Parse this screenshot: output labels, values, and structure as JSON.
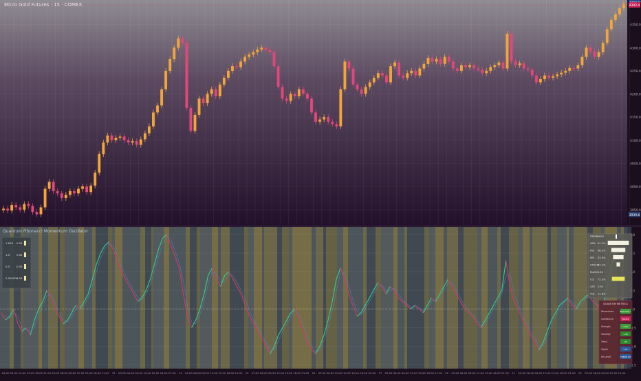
{
  "header": {
    "title": "Micro Gold Futures · 15 · COMEX"
  },
  "oscillator": {
    "title": "Quantum Fibonacci Momentum Oscillator"
  },
  "colors": {
    "bull": "#f2a63a",
    "bear": "#e0477a",
    "osc_up": "#2fd38a",
    "osc_down": "#d63a66",
    "osc_mid": "#3aa7d8",
    "grid": "#3c2b40",
    "accent_high": "#2b4a8c",
    "accent_current": "#c8245a"
  },
  "chart_data": [
    {
      "type": "candlestick",
      "title": "Micro Gold Futures · 15 · COMEX",
      "ylim": [
        3920,
        4400
      ],
      "price_ticks": [
        3950,
        4000,
        4050,
        4100,
        4150,
        4200,
        4250,
        4300,
        4350,
        4400
      ],
      "price_labels": [
        "3950.0",
        "4000.0",
        "4050.0",
        "4100.0",
        "4150.0",
        "4200.0",
        "4250.0",
        "4300.0",
        "4350.0",
        "4400.0"
      ],
      "marker_high": "4398.1",
      "marker_current": "4392.4",
      "marker_low": "3939.6",
      "close_series": [
        3952,
        3948,
        3960,
        3955,
        3950,
        3962,
        3958,
        3945,
        3940,
        3955,
        3995,
        4010,
        3990,
        3985,
        3975,
        3982,
        3990,
        3985,
        3995,
        4000,
        3988,
        4002,
        4030,
        4070,
        4095,
        4110,
        4100,
        4105,
        4108,
        4100,
        4095,
        4098,
        4090,
        4102,
        4115,
        4130,
        4160,
        4175,
        4210,
        4250,
        4275,
        4300,
        4320,
        4310,
        4170,
        4120,
        4155,
        4190,
        4180,
        4200,
        4210,
        4195,
        4220,
        4235,
        4250,
        4260,
        4258,
        4270,
        4280,
        4285,
        4290,
        4296,
        4300,
        4295,
        4290,
        4260,
        4215,
        4190,
        4185,
        4200,
        4195,
        4210,
        4200,
        4190,
        4160,
        4140,
        4145,
        4150,
        4140,
        4135,
        4130,
        4210,
        4270,
        4255,
        4220,
        4210,
        4200,
        4215,
        4225,
        4235,
        4245,
        4240,
        4225,
        4260,
        4268,
        4240,
        4235,
        4245,
        4250,
        4240,
        4255,
        4265,
        4278,
        4270,
        4275,
        4265,
        4280,
        4270,
        4255,
        4250,
        4262,
        4258,
        4262,
        4255,
        4252,
        4245,
        4250,
        4258,
        4262,
        4268,
        4255,
        4330,
        4270,
        4262,
        4266,
        4255,
        4252,
        4240,
        4225,
        4232,
        4240,
        4235,
        4238,
        4242,
        4246,
        4250,
        4256,
        4255,
        4262,
        4280,
        4300,
        4292,
        4280,
        4290,
        4310,
        4340,
        4360,
        4372,
        4385,
        4395
      ]
    },
    {
      "type": "line",
      "title": "Quantum Fibonacci Momentum Oscillator",
      "ylim": [
        -1.6,
        2.2
      ],
      "y_ticks": [
        2.0,
        1.5,
        1.0,
        0.5,
        0.0,
        -0.5,
        -1.0,
        -1.5
      ],
      "y_labels": [
        "2.0",
        "1.5",
        "1.0",
        "0.5",
        "0.0",
        "-0.5",
        "-1.0",
        "-1.5"
      ],
      "x_labels": [
        "09:00",
        "09:00",
        "12:00",
        "15:00",
        "18:00",
        "21:00",
        "03:00",
        "06:00",
        "09:00",
        "12:00",
        "15:00",
        "18:00",
        "21:00",
        "21",
        "03:00",
        "06:00",
        "09:00",
        "12:00",
        "15:00",
        "18:00",
        "21:00",
        "14",
        "03:00",
        "06:00",
        "09:00",
        "12:00",
        "15:00",
        "18:00",
        "21:00",
        "15",
        "03:00",
        "06:00",
        "09:00",
        "12:00",
        "15:00",
        "18:00",
        "21:00",
        "16",
        "03:00",
        "06:00",
        "09:00",
        "12:00",
        "15:00",
        "18:00",
        "21:00",
        "17",
        "03:00",
        "06:00",
        "09:00",
        "12:00",
        "15:00",
        "18:00",
        "21:00",
        "20",
        "03:00",
        "06:00",
        "09:00",
        "12:00",
        "15:00",
        "18:00",
        "21:00",
        "21",
        "03:00",
        "06:00",
        "09:00",
        "12:00",
        "15:00",
        "18:00",
        "21:00",
        "22",
        "03:00",
        "06:00",
        "09:00",
        "12:00",
        "15:00"
      ],
      "series": [
        {
          "values": [
            -0.1,
            -0.3,
            -0.2,
            0.0,
            -0.4,
            -0.6,
            -0.5,
            -0.7,
            -0.3,
            0.0,
            0.2,
            0.5,
            0.3,
            0.0,
            -0.2,
            -0.4,
            -0.3,
            -0.1,
            0.1,
            0.0,
            0.2,
            0.4,
            0.8,
            1.2,
            1.5,
            1.7,
            1.8,
            1.6,
            1.3,
            1.0,
            0.8,
            0.6,
            0.4,
            0.2,
            0.3,
            0.5,
            0.8,
            1.2,
            1.6,
            1.9,
            2.0,
            1.7,
            1.4,
            1.1,
            0.4,
            -0.2,
            -0.5,
            -0.3,
            0.0,
            0.4,
            0.9,
            1.1,
            0.8,
            0.6,
            0.9,
            1.0,
            0.8,
            0.6,
            0.4,
            0.1,
            -0.2,
            -0.4,
            -0.6,
            -0.8,
            -1.0,
            -1.2,
            -1.0,
            -0.7,
            -0.5,
            -0.3,
            -0.1,
            0.0,
            -0.3,
            -0.6,
            -0.9,
            -1.1,
            -1.2,
            -1.0,
            -0.7,
            -0.3,
            0.2,
            0.8,
            1.1,
            0.8,
            0.4,
            0.1,
            -0.2,
            -0.1,
            0.1,
            0.3,
            0.5,
            0.7,
            0.6,
            0.4,
            0.6,
            0.5,
            0.3,
            0.2,
            0.1,
            0.0,
            0.1,
            0.0,
            -0.1,
            0.1,
            0.3,
            0.2,
            0.4,
            0.6,
            0.8,
            0.6,
            0.4,
            0.2,
            0.0,
            -0.1,
            -0.2,
            -0.4,
            -0.5,
            -0.3,
            -0.1,
            0.1,
            0.3,
            0.5,
            1.3,
            0.6,
            0.2,
            0.0,
            -0.3,
            -0.5,
            -0.7,
            -0.9,
            -1.1,
            -0.9,
            -0.6,
            -0.3,
            -0.1,
            0.1,
            0.2,
            0.3,
            0.1,
            0.0,
            0.2,
            0.3,
            0.4,
            0.2,
            0.1,
            -0.2,
            0.4,
            0.9,
            1.4,
            1.6,
            1.5,
            1.6
          ]
        }
      ]
    }
  ],
  "legend_panel": {
    "rows": [
      {
        "label": "1.618",
        "value": "0.00"
      },
      {
        "label": "1.0",
        "value": "0.00"
      },
      {
        "label": "0.5",
        "value": "0.00"
      },
      {
        "label": "0.000000",
        "value": "0.00"
      }
    ]
  },
  "state_panel": {
    "header": [
      "STATE",
      "HIGH"
    ],
    "rows": [
      {
        "label": "ADX",
        "value": "41.2%",
        "bar_fraction": 0.9
      },
      {
        "label": "RSI",
        "value": "68.5%",
        "bar_fraction": 0.6
      },
      {
        "label": "MFI",
        "value": "53.9%",
        "bar_fraction": 0.45
      },
      {
        "label": "STOCH",
        "value": "87.1%",
        "bar_fraction": 0.15
      },
      {
        "label": "MACD",
        "value": "0.61",
        "bar_fraction": 0.0
      },
      {
        "label": "CCI",
        "value": "72.3%",
        "bar_fraction": 0.55
      },
      {
        "label": "ATR",
        "value": "0.95",
        "bar_fraction": 0.0
      },
      {
        "label": "VOL",
        "value": "11.8%",
        "bar_fraction": 0.0
      }
    ]
  },
  "metrics_panel": {
    "title": "QUANTUM METRICS",
    "rows": [
      {
        "label": "Momentum",
        "value": "BULLISH +",
        "color": "#3aa13a"
      },
      {
        "label": "Confidence",
        "value": "89.6%",
        "color": "#c8245a"
      },
      {
        "label": "Strength",
        "value": "1.54",
        "color": "#3aa13a"
      },
      {
        "label": "Volatility",
        "value": "1.46",
        "color": "#2d8a2d"
      },
      {
        "label": "Trend",
        "value": "UP",
        "color": "#2d8a2d"
      },
      {
        "label": "Signal",
        "value": "1.31",
        "color": "#2a5b9e"
      },
      {
        "label": "Fib Level",
        "value": "TREND UP",
        "color": "#2a5b9e"
      }
    ]
  }
}
